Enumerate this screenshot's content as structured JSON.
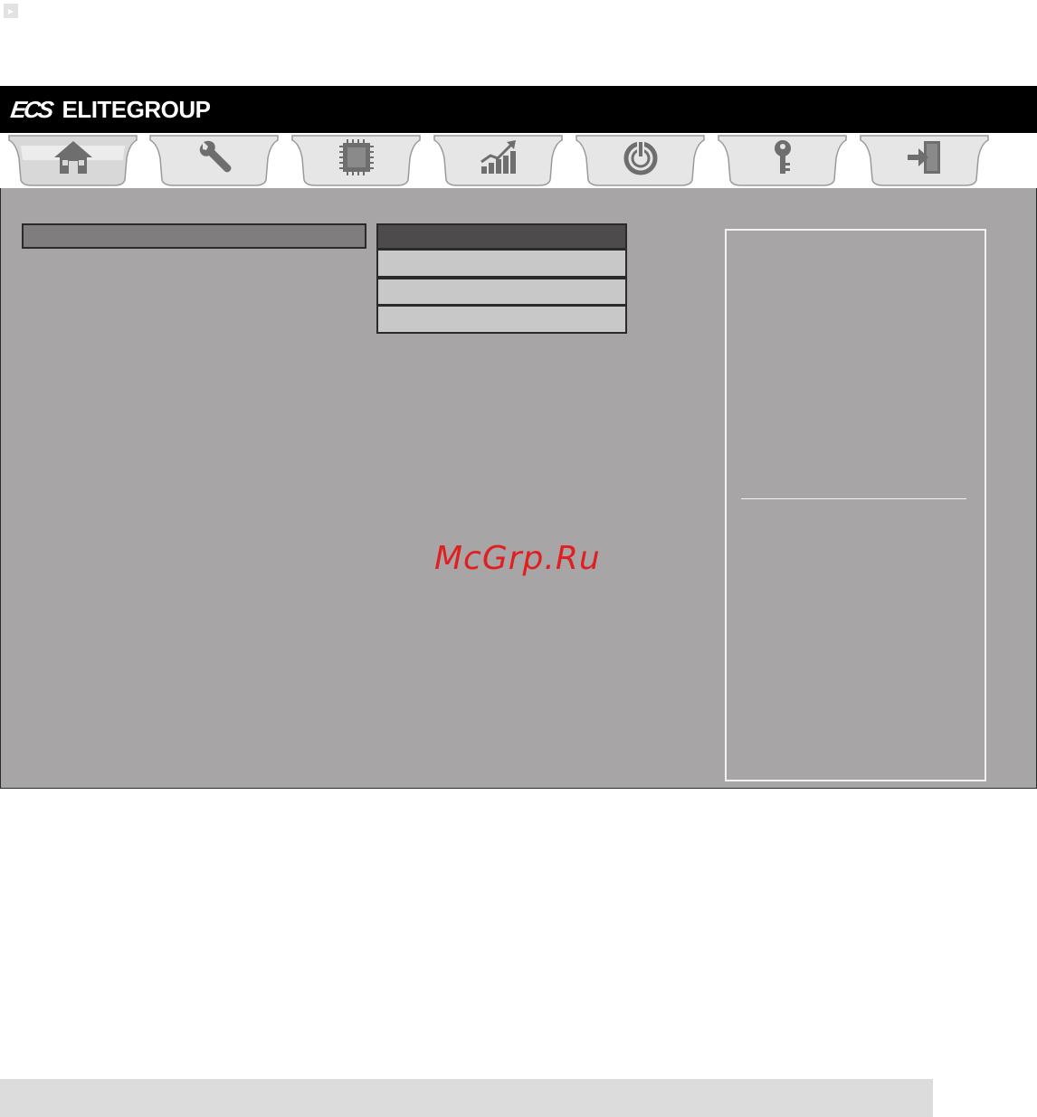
{
  "header": {
    "logo_mark": "ECS",
    "brand_name": "ELITEGROUP"
  },
  "watermark": "McGrp.Ru",
  "tabs": [
    {
      "name": "home",
      "icon": "home-icon"
    },
    {
      "name": "advanced",
      "icon": "wrench-icon"
    },
    {
      "name": "chipset",
      "icon": "chip-icon"
    },
    {
      "name": "mib",
      "icon": "performance-chart-icon"
    },
    {
      "name": "boot",
      "icon": "power-icon"
    },
    {
      "name": "security",
      "icon": "key-icon"
    },
    {
      "name": "exit",
      "icon": "exit-door-icon"
    }
  ],
  "colors": {
    "panel_bg": "#a7a5a6",
    "header_bar": "#000000",
    "watermark": "#e02020",
    "help_border": "#f2f2f2"
  }
}
